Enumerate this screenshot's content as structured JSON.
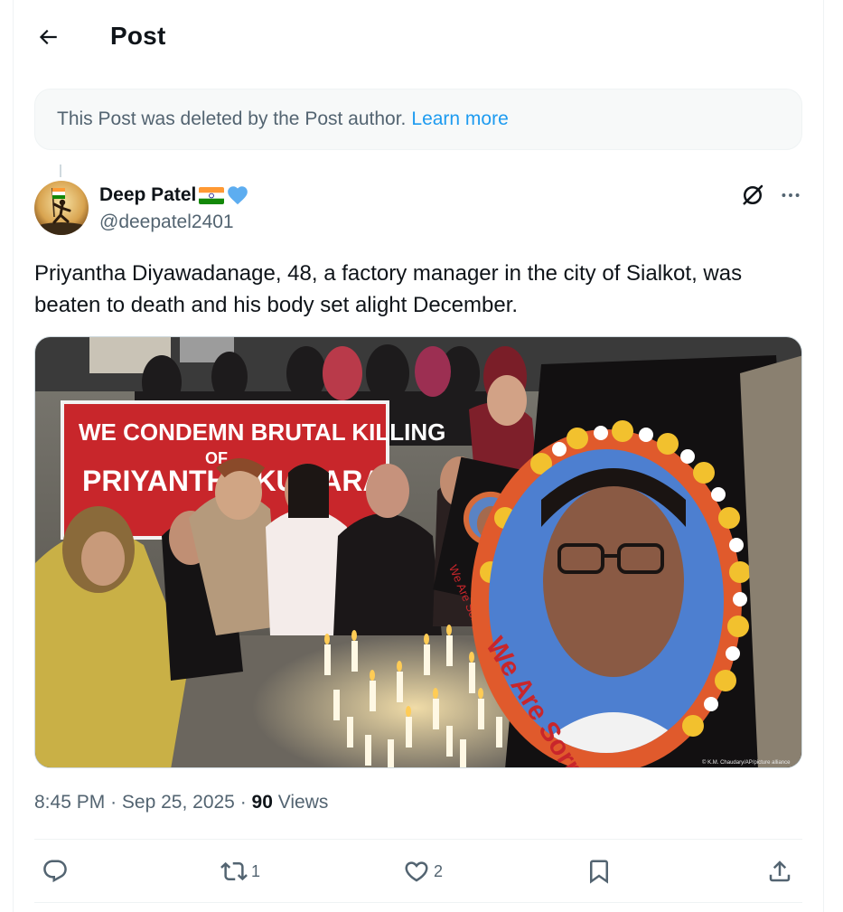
{
  "header": {
    "title": "Post"
  },
  "deleted_notice": {
    "text": "This Post was deleted by the Post author.",
    "link": "Learn more"
  },
  "author": {
    "name": "Deep Patel",
    "handle": "@deepatel2401"
  },
  "post": {
    "text": "Priyantha Diyawadanage, 48, a factory manager in the city of Sialkot, was beaten to death and his body set alight  December."
  },
  "media": {
    "banner_line1": "WE CONDEMN BRUTAL KILLING",
    "banner_line2": "OF",
    "banner_line3": "PRIYANTHA KUMARA",
    "small_sign_text": "We Are Sorry",
    "big_sign_text": "We Are Sorry",
    "credit": "© K.M. Chaudary/AP/picture alliance"
  },
  "meta": {
    "time": "8:45 PM",
    "date": "Sep 25, 2025",
    "views_count": "90",
    "views_label": "Views"
  },
  "actions": {
    "replies": "",
    "reposts": "1",
    "likes": "2"
  },
  "colors": {
    "accent": "#1d9bf0",
    "secondary_text": "#536471",
    "banner_red": "#c8262b"
  }
}
